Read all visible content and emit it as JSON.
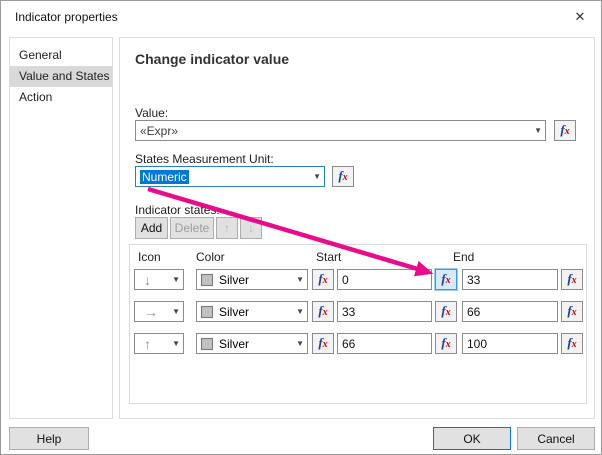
{
  "window": {
    "title": "Indicator properties",
    "close_glyph": "✕"
  },
  "sidebar": {
    "items": [
      {
        "label": "General"
      },
      {
        "label": "Value and States"
      },
      {
        "label": "Action"
      }
    ]
  },
  "main": {
    "heading": "Change indicator value",
    "value": {
      "label": "Value:",
      "text": "«Expr»"
    },
    "unit": {
      "label": "States Measurement Unit:",
      "text": "Numeric"
    },
    "states": {
      "label": "Indicator states:",
      "add_label": "Add",
      "delete_label": "Delete",
      "up_glyph": "↑",
      "down_glyph": "↓",
      "headers": {
        "icon": "Icon",
        "color": "Color",
        "start": "Start",
        "end": "End"
      },
      "rows": [
        {
          "icon_glyph": "↓",
          "color": "Silver",
          "start": "0",
          "end": "33"
        },
        {
          "icon_glyph": "→",
          "color": "Silver",
          "start": "33",
          "end": "66"
        },
        {
          "icon_glyph": "↑",
          "color": "Silver",
          "start": "66",
          "end": "100"
        }
      ]
    }
  },
  "footer": {
    "help": "Help",
    "ok": "OK",
    "cancel": "Cancel"
  },
  "fx": {
    "f": "f",
    "x": "x"
  },
  "glyphs": {
    "caret": "▼"
  },
  "colors": {
    "annotation_pink": "#e80c8c",
    "selection_blue": "#0078d7",
    "silver_swatch": "#c0c0c0"
  }
}
